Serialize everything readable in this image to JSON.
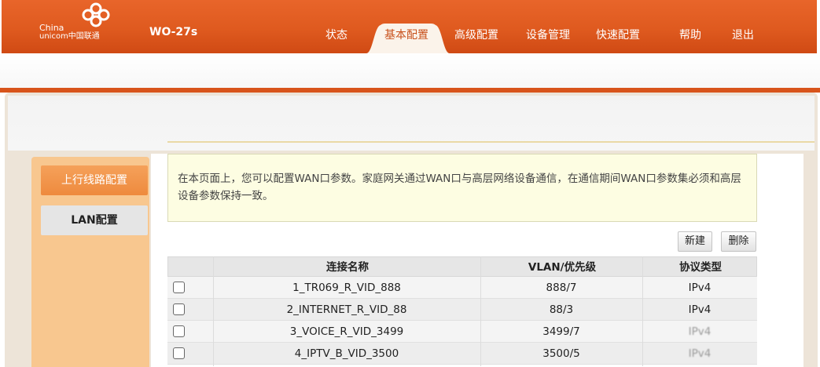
{
  "brand": {
    "logo_line1": "China",
    "logo_line2": "unicom中国联通",
    "model": "WO-27s"
  },
  "nav": {
    "items": [
      "状态",
      "基本配置",
      "高级配置",
      "设备管理",
      "快速配置",
      "帮助",
      "退出"
    ],
    "active_index": 1
  },
  "sidebar": {
    "items": [
      "上行线路配置",
      "LAN配置"
    ],
    "active_index": 0
  },
  "info": {
    "text": "在本页面上，您可以配置WAN口参数。家庭网关通过WAN口与高层网络设备通信，在通信期间WAN口参数集必须和高层设备参数保持一致。"
  },
  "buttons": {
    "new_label": "新建",
    "delete_label": "删除"
  },
  "table": {
    "headers": [
      "",
      "连接名称",
      "VLAN/优先级",
      "协议类型"
    ],
    "rows": [
      {
        "name": "1_TR069_R_VID_888",
        "vlan": "888/7",
        "protocol": "IPv4",
        "checked": false
      },
      {
        "name": "2_INTERNET_R_VID_88",
        "vlan": "88/3",
        "protocol": "IPv4",
        "checked": false
      },
      {
        "name": "3_VOICE_R_VID_3499",
        "vlan": "3499/7",
        "protocol": "IPv4",
        "checked": false
      },
      {
        "name": "4_IPTV_B_VID_3500",
        "vlan": "3500/5",
        "protocol": "IPv4",
        "checked": false
      }
    ]
  },
  "colors": {
    "header_orange": "#df5a1f",
    "sidebar_peach": "#f8c78f",
    "active_tab_text": "#c8501a",
    "info_bg": "#fdfde2"
  }
}
